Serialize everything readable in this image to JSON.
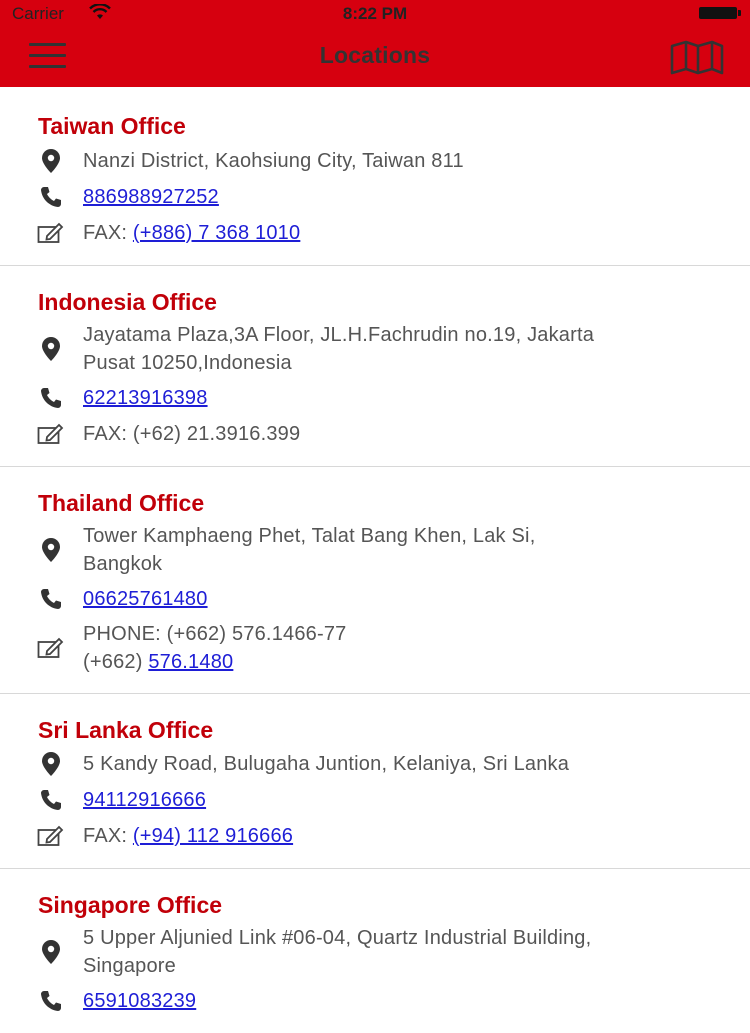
{
  "status_bar": {
    "carrier": "Carrier",
    "time": "8:22 PM"
  },
  "header": {
    "title": "Locations",
    "menu_icon": "hamburger-menu-icon",
    "map_icon": "map-icon"
  },
  "colors": {
    "header_bg": "#d6000f",
    "office_title": "#c10009",
    "link": "#1e1ed6"
  },
  "offices": [
    {
      "name": "Taiwan Office",
      "address": "Nanzi District, Kaohsiung City, Taiwan 811",
      "phone": "886988927252",
      "fax_prefix": "FAX: ",
      "fax_link": "(+886) 7 368 1010"
    },
    {
      "name": "Indonesia Office",
      "address_line1": "Jayatama Plaza,3A Floor, JL.H.Fachrudin no.19, Jakarta",
      "address_line2": "Pusat 10250,Indonesia",
      "phone": "62213916398",
      "fax_text": "FAX: (+62) 21.3916.399"
    },
    {
      "name": "Thailand Office",
      "address_line1": "Tower Kamphaeng Phet, Talat Bang Khen, Lak Si,",
      "address_line2": "Bangkok",
      "phone": "06625761480",
      "fax_line1": "PHONE: (+662) 576.1466-77",
      "fax_line2_prefix": "(+662) ",
      "fax_line2_link": "576.1480"
    },
    {
      "name": "Sri Lanka Office",
      "address": "5 Kandy Road, Bulugaha Juntion, Kelaniya, Sri Lanka",
      "phone": "94112916666",
      "fax_prefix": "FAX: ",
      "fax_link": "(+94) 112 916666"
    },
    {
      "name": "Singapore Office",
      "address_line1": "5 Upper Aljunied Link #06-04, Quartz Industrial Building,",
      "address_line2": "Singapore",
      "phone": "6591083239"
    }
  ]
}
